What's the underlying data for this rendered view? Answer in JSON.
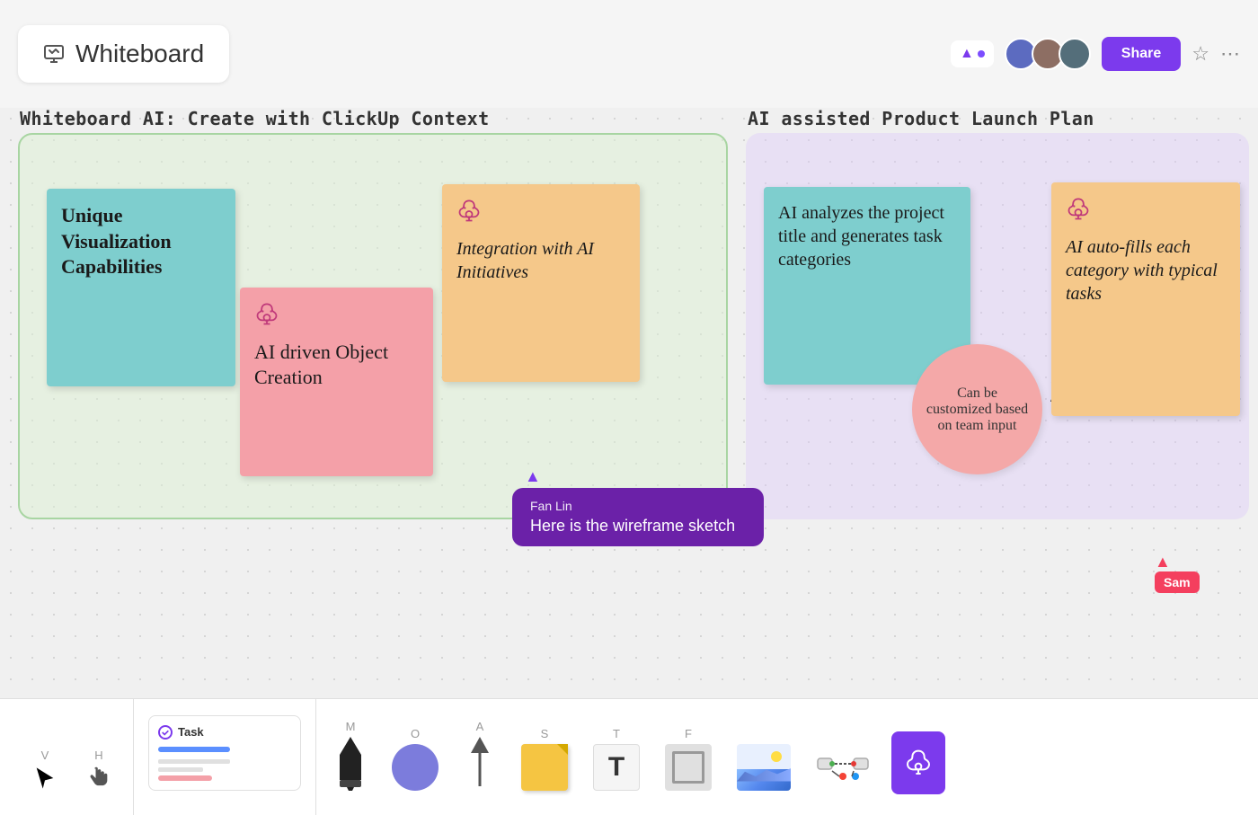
{
  "header": {
    "title": "Whiteboard",
    "share_label": "Share"
  },
  "canvas": {
    "left_section_label": "Whiteboard AI: Create with ClickUp Context",
    "right_section_label": "AI assisted Product Launch Plan",
    "sticky_notes": [
      {
        "id": "teal-left",
        "color": "teal",
        "text": "Unique Visualization Capabilities"
      },
      {
        "id": "pink-mid",
        "color": "pink",
        "text": "AI driven Object Creation"
      },
      {
        "id": "orange-right",
        "color": "orange",
        "text": "Integration with AI Initiatives"
      },
      {
        "id": "teal-right",
        "color": "teal",
        "text": "AI analyzes the project title and generates task categories"
      },
      {
        "id": "orange-far-right",
        "color": "orange",
        "text": "AI auto-fills each category with typical tasks"
      }
    ],
    "circle_text": "Can be customized based on team input",
    "cursor_tooltip": {
      "name": "Fan Lin",
      "message": "Here is the wireframe sketch"
    },
    "sam_label": "Sam"
  },
  "toolbar": {
    "tools": [
      {
        "key": "V",
        "name": "select"
      },
      {
        "key": "H",
        "name": "hand"
      },
      {
        "key": "Task",
        "name": "task"
      },
      {
        "key": "M",
        "name": "marker"
      },
      {
        "key": "O",
        "name": "shape"
      },
      {
        "key": "A",
        "name": "arrow"
      },
      {
        "key": "S",
        "name": "sticky"
      },
      {
        "key": "T",
        "name": "text"
      },
      {
        "key": "F",
        "name": "frame"
      },
      {
        "key": "",
        "name": "image"
      },
      {
        "key": "",
        "name": "connector"
      },
      {
        "key": "",
        "name": "ai-tool"
      }
    ]
  }
}
